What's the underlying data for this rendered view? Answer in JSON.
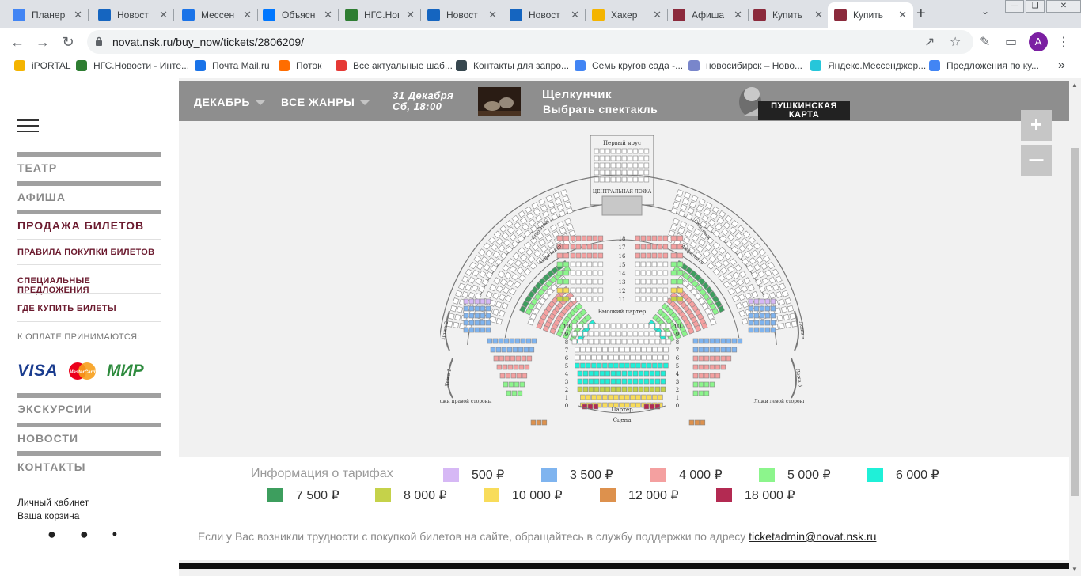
{
  "browser": {
    "tabs": [
      {
        "label": "Планер",
        "color": "#4285f4",
        "active": false
      },
      {
        "label": "Новост",
        "color": "#1565c0",
        "active": false
      },
      {
        "label": "Мессен",
        "color": "#1a73e8",
        "active": false
      },
      {
        "label": "Объясн",
        "color": "#0077ff",
        "active": false
      },
      {
        "label": "НГС.Нов",
        "color": "#2e7d32",
        "active": false
      },
      {
        "label": "Новост",
        "color": "#1565c0",
        "active": false
      },
      {
        "label": "Новост",
        "color": "#1565c0",
        "active": false
      },
      {
        "label": "Хакер",
        "color": "#f4b400",
        "active": false
      },
      {
        "label": "Афиша",
        "color": "#8b2a3c",
        "active": false
      },
      {
        "label": "Купить",
        "color": "#8b2a3c",
        "active": false
      },
      {
        "label": "Купить",
        "color": "#8b2a3c",
        "active": true
      }
    ],
    "url": "novat.nsk.ru/buy_now/tickets/2806209/",
    "avatar_letter": "A",
    "bookmarks": [
      {
        "label": "iPORTAL",
        "color": "#f4b400"
      },
      {
        "label": "НГС.Новости - Инте...",
        "color": "#2e7d32"
      },
      {
        "label": "Почта Mail.ru",
        "color": "#1a73e8"
      },
      {
        "label": "Поток",
        "color": "#ff6d00"
      },
      {
        "label": "Все актуальные шаб...",
        "color": "#e53935"
      },
      {
        "label": "Контакты для запро...",
        "color": "#37474f"
      },
      {
        "label": "Семь кругов сада -...",
        "color": "#4285f4"
      },
      {
        "label": "новосибирск – Ново...",
        "color": "#7986cb"
      },
      {
        "label": "Яндекс.Мессенджер...",
        "color": "#26c6da"
      },
      {
        "label": "Предложения по ку...",
        "color": "#4285f4"
      }
    ],
    "bookmarks_more": "»"
  },
  "sidebar": {
    "menu": {
      "theatre": "ТЕАТР",
      "afisha": "АФИША",
      "tickets": "ПРОДАЖА БИЛЕТОВ",
      "excursions": "ЭКСКУРСИИ",
      "news": "НОВОСТИ",
      "contacts": "КОНТАКТЫ"
    },
    "submenu": {
      "rules": "ПРАВИЛА ПОКУПКИ БИЛЕТОВ",
      "special": "СПЕЦИАЛЬНЫЕ ПРЕДЛОЖЕНИЯ",
      "where": "ГДЕ КУПИТЬ БИЛЕТЫ",
      "payment": "К ОПЛАТЕ ПРИНИМАЮТСЯ:"
    },
    "payment": {
      "visa": "VISA",
      "mastercard": "MasterCard",
      "mir": "МИР"
    },
    "account": "Личный кабинет",
    "cart": "Ваша корзина"
  },
  "filters": {
    "month": "ДЕКАБРЬ",
    "genre": "ВСЕ ЖАНРЫ",
    "date": "31 Декабря",
    "time": "Сб, 18:00",
    "show_title": "Щелкунчик",
    "show_select": "Выбрать спектакль",
    "pushkin_card": "ПУШКИНСКАЯ КАРТА"
  },
  "zoom": {
    "in": "+",
    "out": "—"
  },
  "hall": {
    "labels": {
      "first_tier": "Первый ярус",
      "central_box": "ЦЕНТРАЛЬНАЯ ЛОЖА",
      "balcony": "Бельэтаж",
      "amphitheatre": "Амфитеатр",
      "high_parterre": "Высокий партер",
      "parterre": "Партер",
      "stage": "Сцена",
      "box2": "Ложа 2",
      "box1": "Ложа 1",
      "box3": "Ложа 3",
      "box4": "Ложа 4",
      "right_boxes": "Ложи правой стороны",
      "left_boxes": "Ложи левой стороны"
    }
  },
  "legend": {
    "title": "Информация о тарифах",
    "items": [
      {
        "price": "500 ₽",
        "color": "#d6b8f5"
      },
      {
        "price": "3 500 ₽",
        "color": "#7fb4ef"
      },
      {
        "price": "4 000 ₽",
        "color": "#f4a0a0"
      },
      {
        "price": "5 000 ₽",
        "color": "#8cf58c"
      },
      {
        "price": "6 000 ₽",
        "color": "#1ff0d8"
      },
      {
        "price": "7 500 ₽",
        "color": "#3d9e5e"
      },
      {
        "price": "8 000 ₽",
        "color": "#c5d24a"
      },
      {
        "price": "10 000 ₽",
        "color": "#f8dc5a"
      },
      {
        "price": "12 000 ₽",
        "color": "#dd914d"
      },
      {
        "price": "18 000 ₽",
        "color": "#b32a52"
      }
    ]
  },
  "support": {
    "text": "Если у Вас возникли трудности с покупкой билетов на сайте, обращайтесь в службу поддержки по адресу",
    "email": "ticketadmin@novat.nsk.ru"
  }
}
